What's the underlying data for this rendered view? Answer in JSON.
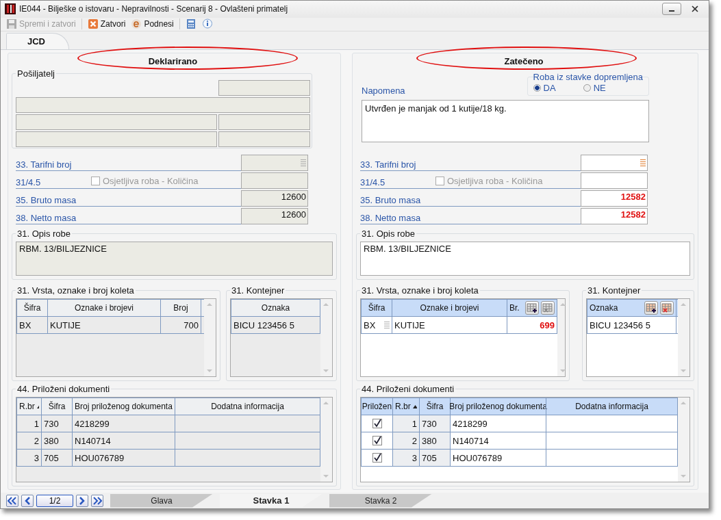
{
  "window": {
    "title": "IE044 - Bilješke o istovaru - Nepravilnosti - Scenarij 8 - Ovlašteni primatelj"
  },
  "toolbar": [
    {
      "kind": "save",
      "label": "Spremi i zatvori",
      "disabled": true
    },
    {
      "kind": "close",
      "label": "Zatvori",
      "disabled": false
    },
    {
      "kind": "submit",
      "label": "Podnesi",
      "disabled": false
    },
    {
      "kind": "calculator",
      "disabled": false
    },
    {
      "kind": "info",
      "disabled": false
    }
  ],
  "tabs": [
    {
      "label": "JCD",
      "selected": true
    }
  ],
  "panels": [
    {
      "heading": "Deklarirano",
      "readonly": true,
      "top": {
        "kind": "sender",
        "label": "Pošiljatelj"
      },
      "fields": [
        {
          "kind": "lookup",
          "label": "33. Tarifni broj"
        },
        {
          "kind": "checkbox",
          "label": "31/4.5",
          "checkbox_label": "Osjetljiva roba - Količina",
          "checked": false
        },
        {
          "kind": "number",
          "label": "35. Bruto masa",
          "value": "12600",
          "changed": false
        },
        {
          "kind": "number",
          "label": "38. Netto masa",
          "value": "12600",
          "changed": false
        }
      ],
      "description": {
        "label": "31. Opis robe",
        "value": "RBM. 13/BILJEZNICE"
      },
      "packages": {
        "label": "31. Vrsta, oznake i broj koleta",
        "columns": [
          "Šifra",
          "Oznake i brojevi",
          "Broj"
        ],
        "rows": [
          {
            "code": "BX",
            "marks": "KUTIJE",
            "count": "700",
            "changed": false
          }
        ]
      },
      "containers": {
        "label": "31. Kontejner",
        "columns": [
          "Oznaka"
        ],
        "rows": [
          "BICU 123456 5"
        ]
      },
      "documents": {
        "label": "44. Priloženi dokumenti",
        "columns": [
          {
            "label": "R.br",
            "sorted": true
          },
          {
            "label": "Šifra",
            "sorted": false
          },
          {
            "label": "Broj priloženog dokumenta",
            "sorted": false
          },
          {
            "label": "Dodatna informacija",
            "sorted": false
          }
        ],
        "rows": [
          {
            "no": "1",
            "code": "730",
            "number": "4218299"
          },
          {
            "no": "2",
            "code": "380",
            "number": "N140714"
          },
          {
            "no": "3",
            "code": "705",
            "number": "HOU076789"
          }
        ]
      }
    },
    {
      "heading": "Zatečeno",
      "readonly": false,
      "top": {
        "kind": "note",
        "label": "Napomena",
        "value": "Utvrđen je manjak od 1 kutije/18 kg.",
        "radio_group": {
          "label": "Roba iz stavke dopremljena",
          "options": [
            {
              "label": "DA",
              "selected": true
            },
            {
              "label": "NE",
              "selected": false
            }
          ]
        }
      },
      "fields": [
        {
          "kind": "lookup",
          "label": "33. Tarifni broj"
        },
        {
          "kind": "checkbox",
          "label": "31/4.5",
          "checkbox_label": "Osjetljiva roba - Količina",
          "checked": false
        },
        {
          "kind": "number",
          "label": "35. Bruto masa",
          "value": "12582",
          "changed": true
        },
        {
          "kind": "number",
          "label": "38. Netto masa",
          "value": "12582",
          "changed": true
        }
      ],
      "description": {
        "label": "31. Opis robe",
        "value": "RBM. 13/BILJEZNICE"
      },
      "packages": {
        "label": "31. Vrsta, oznake i broj koleta",
        "columns": [
          "Šifra",
          "Oznake i brojevi",
          "Br."
        ],
        "rows": [
          {
            "code": "BX",
            "marks": "KUTIJE",
            "count": "699",
            "changed": true
          }
        ]
      },
      "containers": {
        "label": "31. Kontejner",
        "columns": [
          "Oznaka"
        ],
        "rows": [
          "BICU 123456 5"
        ]
      },
      "documents": {
        "label": "44. Priloženi dokumenti",
        "columns": [
          {
            "label": "Priložen",
            "sorted": false
          },
          {
            "label": "R.br",
            "sorted": true
          },
          {
            "label": "Šifra",
            "sorted": false
          },
          {
            "label": "Broj priloženog dokumenta",
            "sorted": false
          },
          {
            "label": "Dodatna informacija",
            "sorted": false
          }
        ],
        "rows": [
          {
            "attached": true,
            "no": "1",
            "code": "730",
            "number": "4218299"
          },
          {
            "attached": true,
            "no": "2",
            "code": "380",
            "number": "N140714"
          },
          {
            "attached": true,
            "no": "3",
            "code": "705",
            "number": "HOU076789"
          }
        ]
      }
    }
  ],
  "navigation": {
    "page": "1/2",
    "tabs": [
      {
        "label": "Glava",
        "selected": false
      },
      {
        "label": "Stavka 1",
        "selected": true
      },
      {
        "label": "Stavka 2",
        "selected": false
      }
    ]
  }
}
